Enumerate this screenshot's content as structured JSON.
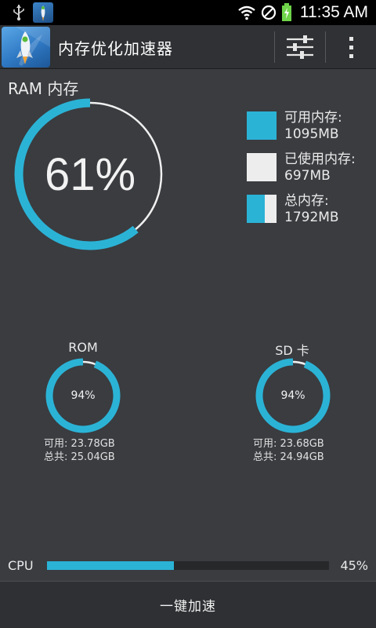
{
  "status_bar": {
    "time": "11:35 AM",
    "icons": [
      "usb-icon",
      "app-notification-icon",
      "wifi-icon",
      "no-signal-icon",
      "battery-charging-icon"
    ]
  },
  "app_bar": {
    "title": "内存优化加速器",
    "actions": [
      "settings-sliders-icon",
      "overflow-menu-icon"
    ]
  },
  "ram": {
    "label": "RAM 内存",
    "percent_text": "61%",
    "used_fraction": 0.61,
    "legend": [
      {
        "label": "可用内存:",
        "value": "1095MB",
        "swatch": "available"
      },
      {
        "label": "已使用内存:",
        "value": "697MB",
        "swatch": "used"
      },
      {
        "label": "总内存:",
        "value": "1792MB",
        "swatch": "total"
      }
    ]
  },
  "storage": {
    "rom": {
      "title": "ROM",
      "percent_text": "94%",
      "fraction": 0.94,
      "available": "可用: 23.78GB",
      "total": "总共: 25.04GB"
    },
    "sd": {
      "title": "SD 卡",
      "percent_text": "94%",
      "fraction": 0.94,
      "available": "可用: 23.68GB",
      "total": "总共: 24.94GB"
    }
  },
  "cpu": {
    "label": "CPU",
    "percent_text": "45%",
    "fraction": 0.45
  },
  "boost_button": {
    "label": "一键加速"
  },
  "colors": {
    "accent": "#2bb3d6",
    "background": "#3a3c40",
    "used_swatch": "#ededed",
    "track": "#26282a"
  }
}
